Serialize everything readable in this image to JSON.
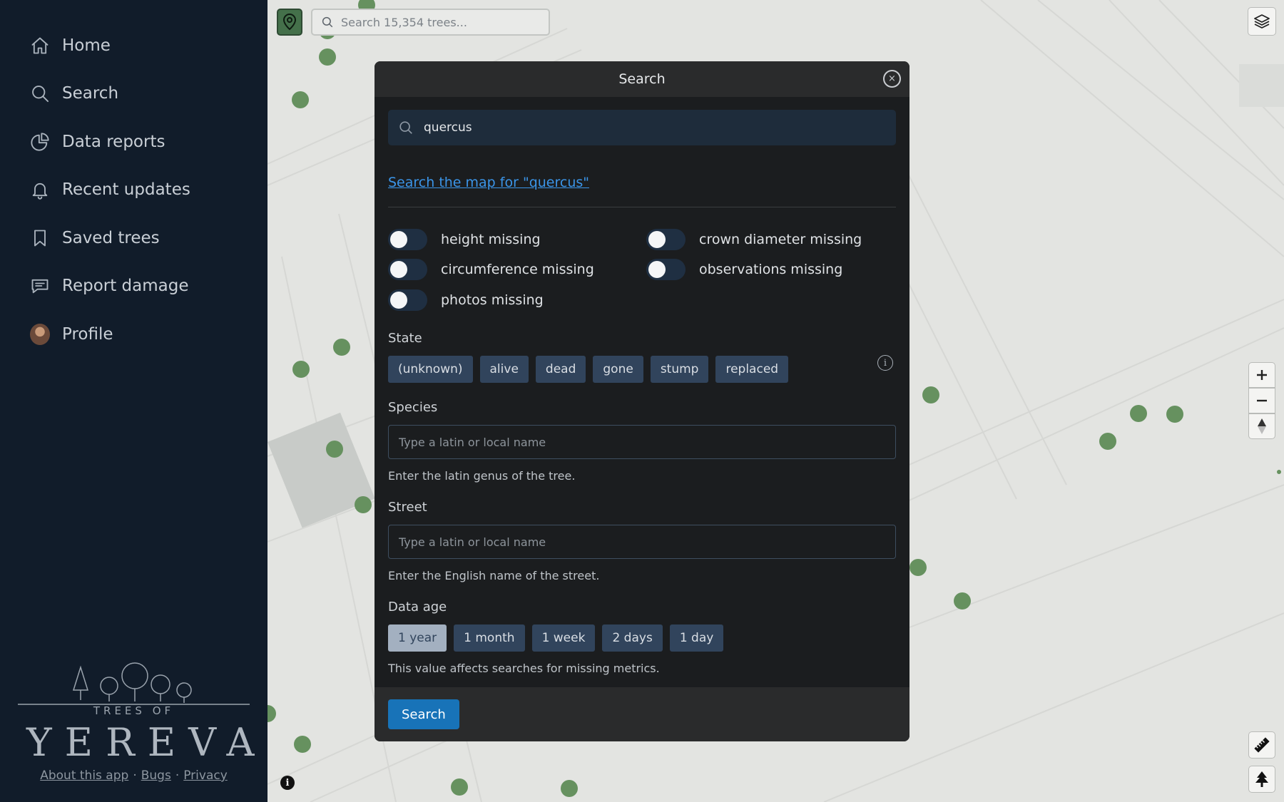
{
  "sidebar": {
    "items": [
      {
        "label": "Home",
        "icon": "home-icon"
      },
      {
        "label": "Search",
        "icon": "search-icon"
      },
      {
        "label": "Data reports",
        "icon": "pie-chart-icon"
      },
      {
        "label": "Recent updates",
        "icon": "bell-icon"
      },
      {
        "label": "Saved trees",
        "icon": "bookmark-icon"
      },
      {
        "label": "Report damage",
        "icon": "message-icon"
      },
      {
        "label": "Profile",
        "icon": "avatar"
      }
    ],
    "logo": {
      "line1": "TREES OF",
      "line2": "YEREVAN"
    },
    "footer": {
      "about": "About this app",
      "bugs": "Bugs",
      "privacy": "Privacy",
      "separator": "·"
    }
  },
  "map": {
    "search_placeholder": "Search 15,354 trees...",
    "tree_color": "#66915f",
    "info_label": "i"
  },
  "modal": {
    "title": "Search",
    "close_label": "×",
    "query": "quercus",
    "map_link": "Search the map for \"quercus\"",
    "toggles": [
      {
        "label": "height missing",
        "on": false
      },
      {
        "label": "crown diameter missing",
        "on": false
      },
      {
        "label": "circumference missing",
        "on": false
      },
      {
        "label": "observations missing",
        "on": false
      },
      {
        "label": "photos missing",
        "on": false
      }
    ],
    "state": {
      "label": "State",
      "options": [
        "(unknown)",
        "alive",
        "dead",
        "gone",
        "stump",
        "replaced"
      ],
      "info_label": "i"
    },
    "species": {
      "label": "Species",
      "placeholder": "Type a latin or local name",
      "help": "Enter the latin genus of the tree."
    },
    "street": {
      "label": "Street",
      "placeholder": "Type a latin or local name",
      "help": "Enter the English name of the street."
    },
    "data_age": {
      "label": "Data age",
      "options": [
        "1 year",
        "1 month",
        "1 week",
        "2 days",
        "1 day"
      ],
      "selected": "1 year",
      "help": "This value affects searches for missing metrics."
    },
    "submit_label": "Search"
  },
  "colors": {
    "sidebar_bg": "#111c2a",
    "modal_bg": "#1b1d1f",
    "chip_bg": "#31445c",
    "link": "#3b95e8",
    "primary": "#1873b8"
  }
}
